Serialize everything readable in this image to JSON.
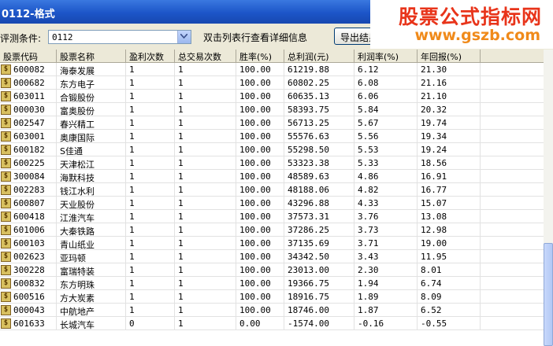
{
  "window": {
    "title": "0112-格式"
  },
  "watermark": {
    "line1": "股票公式指标网",
    "line2": "www.gszb.com"
  },
  "toolbar": {
    "condition_label": "评测条件:",
    "condition_value": "0112",
    "hint": "双击列表行查看详细信息",
    "export_label": "导出结果"
  },
  "table": {
    "columns": [
      "股票代码",
      "股票名称",
      "盈利次数",
      "总交易次数",
      "胜率(%)",
      "总利润(元)",
      "利润率(%)",
      "年回报(%)"
    ],
    "rows": [
      [
        "600082",
        "海泰发展",
        "1",
        "1",
        "100.00",
        "61219.88",
        "6.12",
        "21.30"
      ],
      [
        "000682",
        "东方电子",
        "1",
        "1",
        "100.00",
        "60802.25",
        "6.08",
        "21.16"
      ],
      [
        "603011",
        "合锻股份",
        "1",
        "1",
        "100.00",
        "60635.13",
        "6.06",
        "21.10"
      ],
      [
        "000030",
        "富奥股份",
        "1",
        "1",
        "100.00",
        "58393.75",
        "5.84",
        "20.32"
      ],
      [
        "002547",
        "春兴精工",
        "1",
        "1",
        "100.00",
        "56713.25",
        "5.67",
        "19.74"
      ],
      [
        "603001",
        "奥康国际",
        "1",
        "1",
        "100.00",
        "55576.63",
        "5.56",
        "19.34"
      ],
      [
        "600182",
        "S佳通",
        "1",
        "1",
        "100.00",
        "55298.50",
        "5.53",
        "19.24"
      ],
      [
        "600225",
        "天津松江",
        "1",
        "1",
        "100.00",
        "53323.38",
        "5.33",
        "18.56"
      ],
      [
        "300084",
        "海默科技",
        "1",
        "1",
        "100.00",
        "48589.63",
        "4.86",
        "16.91"
      ],
      [
        "002283",
        "钱江水利",
        "1",
        "1",
        "100.00",
        "48188.06",
        "4.82",
        "16.77"
      ],
      [
        "600807",
        "天业股份",
        "1",
        "1",
        "100.00",
        "43296.88",
        "4.33",
        "15.07"
      ],
      [
        "600418",
        "江淮汽车",
        "1",
        "1",
        "100.00",
        "37573.31",
        "3.76",
        "13.08"
      ],
      [
        "601006",
        "大秦铁路",
        "1",
        "1",
        "100.00",
        "37286.25",
        "3.73",
        "12.98"
      ],
      [
        "600103",
        "青山纸业",
        "1",
        "1",
        "100.00",
        "37135.69",
        "3.71",
        "19.00"
      ],
      [
        "002623",
        "亚玛顿",
        "1",
        "1",
        "100.00",
        "34342.50",
        "3.43",
        "11.95"
      ],
      [
        "300228",
        "富瑞特装",
        "1",
        "1",
        "100.00",
        "23013.00",
        "2.30",
        "8.01"
      ],
      [
        "600832",
        "东方明珠",
        "1",
        "1",
        "100.00",
        "19366.75",
        "1.94",
        "6.74"
      ],
      [
        "600516",
        "方大炭素",
        "1",
        "1",
        "100.00",
        "18916.75",
        "1.89",
        "8.09"
      ],
      [
        "000043",
        "中航地产",
        "1",
        "1",
        "100.00",
        "18746.00",
        "1.87",
        "6.52"
      ],
      [
        "601633",
        "长城汽车",
        "0",
        "1",
        "0.00",
        "-1574.00",
        "-0.16",
        "-0.55"
      ]
    ]
  },
  "row_icon": "dollar-icon"
}
